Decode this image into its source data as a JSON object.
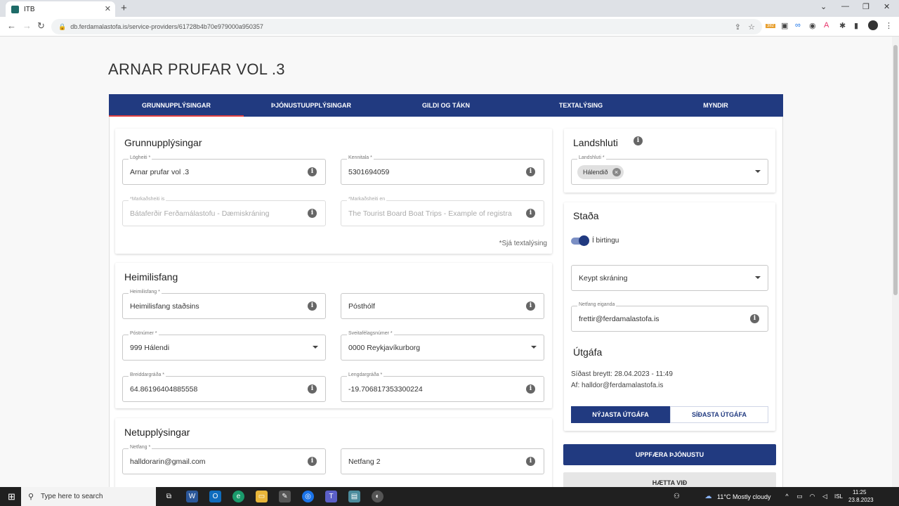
{
  "browser": {
    "tab_title": "ITB",
    "url": "db.ferdamalastofa.is/service-providers/61728b4b70e979000a950357",
    "ext_badge": "382"
  },
  "page": {
    "title": "ARNAR PRUFAR VOL .3"
  },
  "tabs": [
    "GRUNNUPPLÝSINGAR",
    "ÞJÓNUSTUUPPLÝSINGAR",
    "GILDI OG TÁKN",
    "TEXTALÝSING",
    "MYNDIR"
  ],
  "grunn": {
    "heading": "Grunnupplýsingar",
    "logheiti": {
      "label": "Lögheiti *",
      "value": "Arnar prufar vol .3"
    },
    "kennitala": {
      "label": "Kennitala *",
      "value": "5301694059"
    },
    "mark_is": {
      "label": "*Markaðsheiti is",
      "value": "Bátaferðir Ferðamálastofu - Dæmiskráning"
    },
    "mark_en": {
      "label": "*Markaðsheiti en",
      "value": "The Tourist Board Boat Trips - Example of registra"
    },
    "note": "*Sjá textalýsing"
  },
  "heimili": {
    "heading": "Heimilisfang",
    "heimilisfang": {
      "label": "Heimilisfang *",
      "value": "Heimilisfang staðsins"
    },
    "postholf": {
      "value": "Pósthólf"
    },
    "postnumer": {
      "label": "Póstnúmer *",
      "value": "999 Hálendi"
    },
    "sveitarfelag": {
      "label": "Sveitafélagsnúmer *",
      "value": "0000 Reykjavíkurborg"
    },
    "breidd": {
      "label": "Breiddargráða *",
      "value": "64.86196404885558"
    },
    "lengd": {
      "label": "Lengdargráða *",
      "value": "-19.706817353300224"
    }
  },
  "netupp": {
    "heading": "Netupplýsingar",
    "netfang": {
      "label": "Netfang *",
      "value": "halldorarin@gmail.com"
    },
    "netfang2": {
      "value": "Netfang 2"
    }
  },
  "landshluti": {
    "heading": "Landshluti",
    "label": "Landshluti *",
    "chip": "Hálendið"
  },
  "stada": {
    "heading": "Staða",
    "toggle_label": "Í birtingu",
    "select": "Keypt skráning",
    "owner_label": "Netfang eiganda",
    "owner_value": "frettir@ferdamalastofa.is"
  },
  "utgafa": {
    "heading": "Útgáfa",
    "changed": "Síðast breytt: 28.04.2023 - 11:49",
    "by": "Af: halldor@ferdamalastofa.is",
    "newest": "NÝJASTA ÚTGÁFA",
    "last": "SÍÐASTA ÚTGÁFA"
  },
  "actions": {
    "update": "UPPFÆRA ÞJÓNUSTU",
    "cancel": "HÆTTA VIÐ"
  },
  "taskbar": {
    "search": "Type here to search",
    "weather": "11°C  Mostly cloudy",
    "lang": "ISL",
    "time": "11:25",
    "date": "23.8.2023"
  },
  "colors": {
    "primary": "#213a80",
    "tab_indicator": "#e14040"
  }
}
